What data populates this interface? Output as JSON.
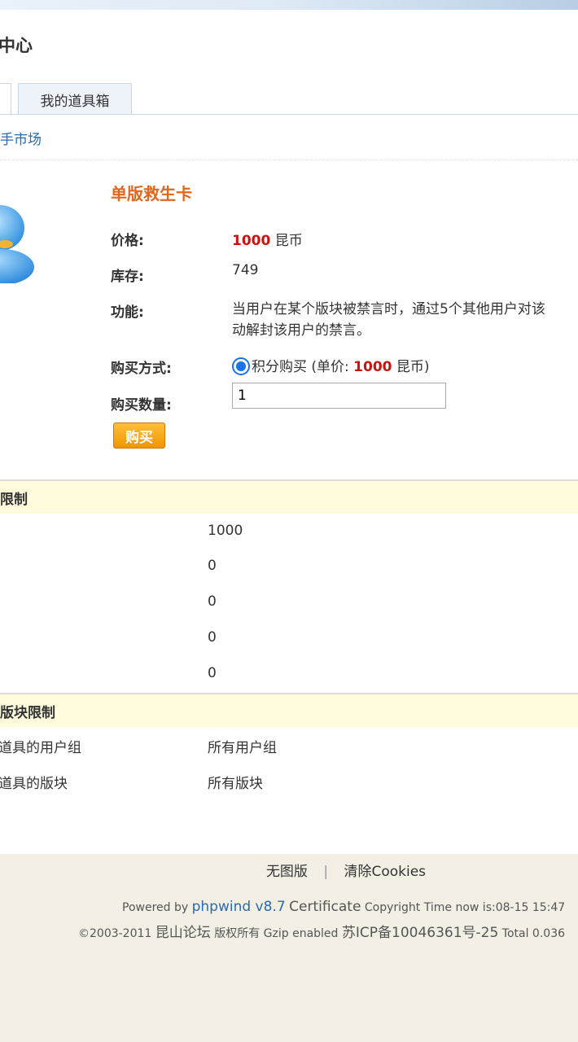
{
  "header": {
    "title": "中心"
  },
  "tabs": [
    {
      "label": ""
    },
    {
      "label": "我的道具箱"
    }
  ],
  "breadcrumb": "手市场",
  "item": {
    "name": "单版救生卡",
    "price_label": "价格:",
    "price_value": "1000",
    "price_unit": "昆币",
    "stock_label": "库存:",
    "stock_value": "749",
    "function_label": "功能:",
    "function_line1": "当用户在某个版块被禁言时，通过5个其他用户对该",
    "function_line2": "动解封该用户的禁言。",
    "purchase_method_label": "购买方式:",
    "purchase_method_text": "积分购买 (单价:",
    "purchase_method_price": "1000",
    "purchase_method_unit": "昆币)",
    "quantity_label": "购买数量:",
    "quantity_value": "1",
    "buy_button": "购买"
  },
  "limits_section": {
    "title": "限制",
    "values": [
      "1000",
      "0",
      "0",
      "0",
      "0"
    ]
  },
  "board_section": {
    "title": "版块限制",
    "rows": [
      {
        "label": "道具的用户组",
        "value": "所有用户组"
      },
      {
        "label": "道具的版块",
        "value": "所有版块"
      }
    ]
  },
  "footer": {
    "link_text_only": "无图版",
    "link_clear_cookies": "清除Cookies",
    "separator": "|",
    "powered_by": "Powered by",
    "phpwind": "phpwind v8.7",
    "certificate": "Certificate",
    "copyright_time": "Copyright Time now is:08-15 15:47",
    "copyright_prefix": "©2003-2011",
    "site_name": "昆山论坛",
    "rights": "版权所有 Gzip enabled",
    "icp": "苏ICP备10046361号-25",
    "total": "Total 0.036"
  }
}
